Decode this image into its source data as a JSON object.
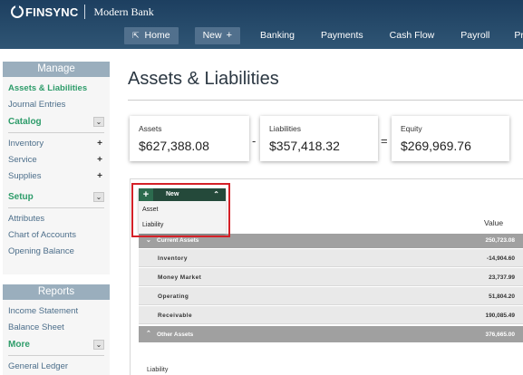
{
  "header": {
    "brand_name": "FINSYNC",
    "bank_name": "Modern Bank",
    "nav": [
      {
        "label": "Home"
      },
      {
        "label": "New"
      },
      {
        "label": "Banking"
      },
      {
        "label": "Payments"
      },
      {
        "label": "Cash Flow"
      },
      {
        "label": "Payroll"
      },
      {
        "label": "Proje"
      }
    ]
  },
  "sidebar": {
    "manage_title": "Manage",
    "manage_links": [
      "Assets & Liabilities",
      "Journal Entries"
    ],
    "catalog_label": "Catalog",
    "catalog_items": [
      "Inventory",
      "Service",
      "Supplies"
    ],
    "setup_label": "Setup",
    "setup_items": [
      "Attributes",
      "Chart of Accounts",
      "Opening Balance"
    ],
    "reports_title": "Reports",
    "reports_links": [
      "Income Statement",
      "Balance Sheet"
    ],
    "more_label": "More",
    "more_items": [
      "General Ledger"
    ]
  },
  "main": {
    "title": "Assets & Liabilities",
    "cards": [
      {
        "label": "Assets",
        "value": "$627,388.08"
      },
      {
        "label": "Liabilities",
        "value": "$357,418.32"
      },
      {
        "label": "Equity",
        "value": "$269,969.76"
      }
    ],
    "operators": [
      "-",
      "="
    ],
    "value_header": "Value",
    "groups": [
      {
        "label": "Current Assets",
        "value": "250,723.08"
      },
      {
        "label": "Other Assets",
        "value": "376,665.00"
      }
    ],
    "current_asset_rows": [
      {
        "label": "Inventory",
        "value": "-14,904.60"
      },
      {
        "label": "Money Market",
        "value": "23,737.99"
      },
      {
        "label": "Operating",
        "value": "51,804.20"
      },
      {
        "label": "Receivable",
        "value": "190,085.49"
      }
    ],
    "liability_label": "Liability"
  },
  "new_dropdown": {
    "plus": "+",
    "label": "New",
    "options": [
      "Asset",
      "Liability"
    ]
  },
  "colors": {
    "header_top": "#1d3f60",
    "accent_green": "#2e9c6a",
    "highlight_red": "#d42027"
  }
}
